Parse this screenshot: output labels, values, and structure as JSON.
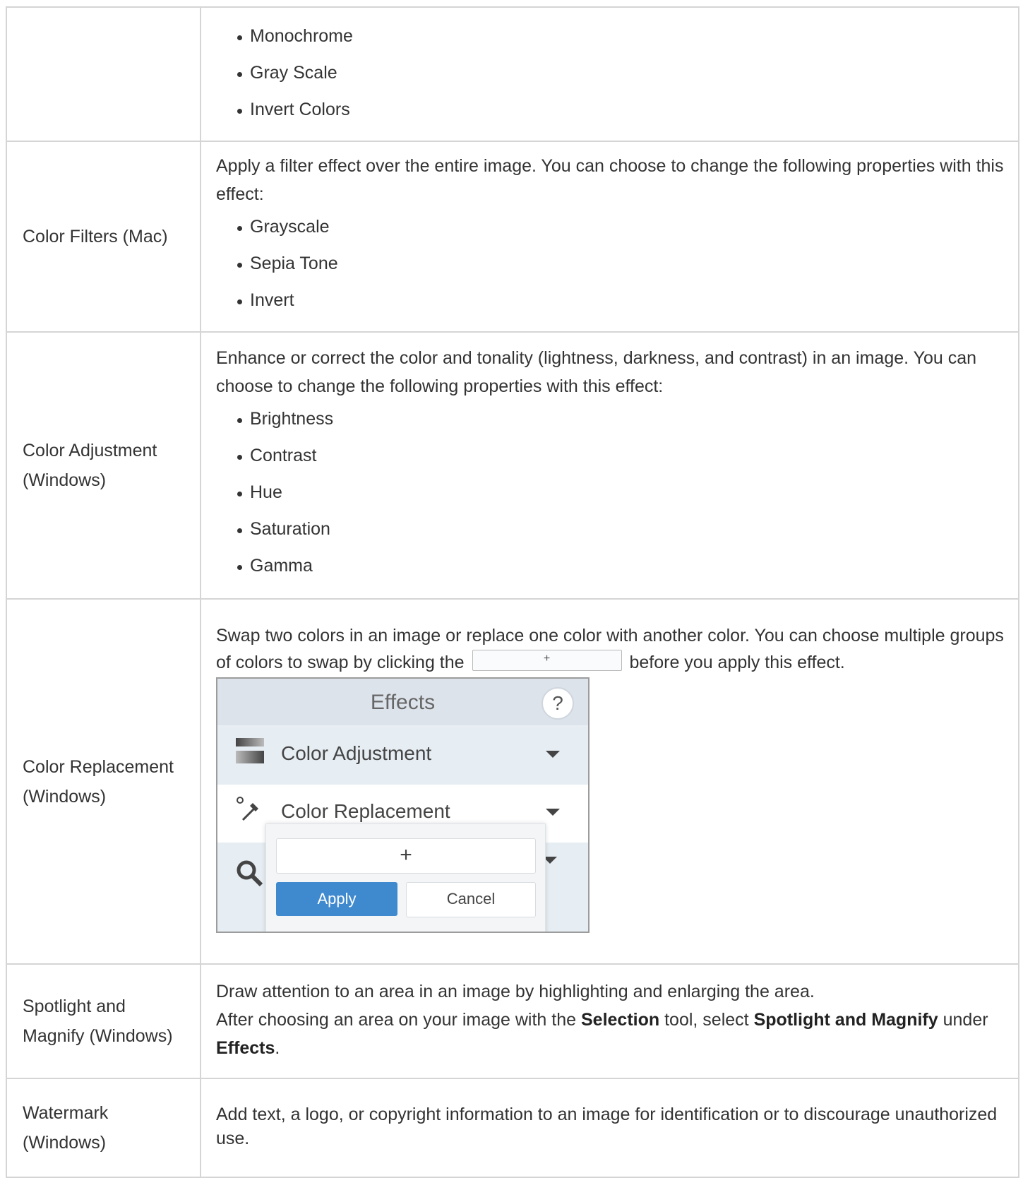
{
  "rows": [
    {
      "name": "",
      "description": "",
      "items": [
        "Monochrome",
        "Gray Scale",
        "Invert Colors"
      ]
    },
    {
      "name": "Color Filters (Mac)",
      "description": "Apply a filter effect over the entire image. You can choose to change the following properties with this effect:",
      "items": [
        "Grayscale",
        "Sepia Tone",
        "Invert"
      ]
    },
    {
      "name": "Color Adjustment (Windows)",
      "description": "Enhance or correct the color and tonality (lightness, darkness, and contrast) in an image. You can choose to change the following properties with this effect:",
      "items": [
        "Brightness",
        "Contrast",
        "Hue",
        "Saturation",
        "Gamma"
      ]
    },
    {
      "name": "Color Replacement (Windows)",
      "description_before": "Swap two colors in an image or replace one color with another color. You can choose multiple groups of colors to swap by clicking the",
      "inline_button": "+",
      "description_after": "before you apply this effect."
    },
    {
      "name": "Spotlight and Magnify (Windows)",
      "line1": "Draw attention to an area in an image by highlighting and enlarging the area.",
      "line2_a": "After choosing an area on your image with the",
      "line2_b": "Selection",
      "line2_c": "tool, select",
      "line2_d": "Spotlight and Magnify",
      "line2_e": "under",
      "line2_f": "Effects",
      "line2_g": "."
    },
    {
      "name": "Watermark (Windows)",
      "description": "Add text, a logo, or copyright information to an image for identification or to discourage unauthorized use."
    }
  ],
  "effects_panel": {
    "title": "Effects",
    "help": "?",
    "items": [
      "Color Adjustment",
      "Color Replacement"
    ],
    "add": "+",
    "apply": "Apply",
    "cancel": "Cancel",
    "icons": [
      "gradient-bars-icon",
      "eyedropper-icon",
      "magnifier-icon"
    ],
    "accent": "#3f89cf"
  }
}
